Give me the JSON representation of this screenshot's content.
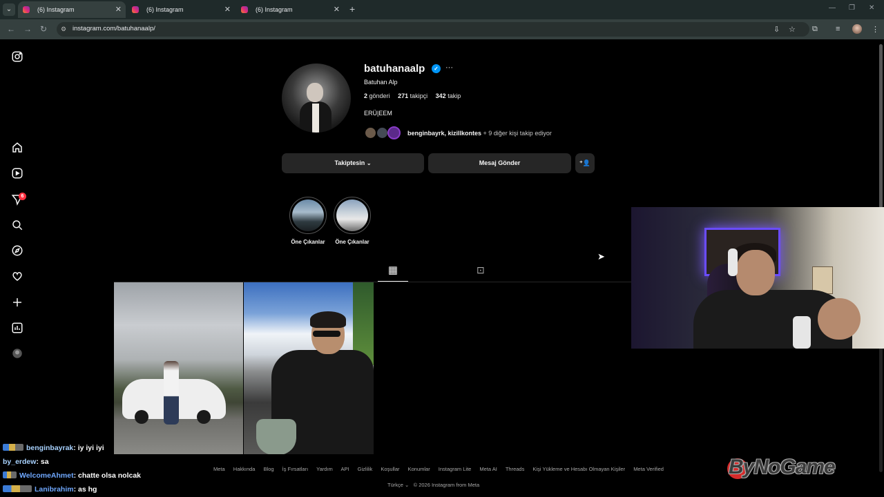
{
  "browser": {
    "tabs": [
      {
        "title": "(6) Instagram",
        "active": true
      },
      {
        "title": "(6) Instagram",
        "active": false
      },
      {
        "title": "(6) Instagram",
        "active": false
      }
    ],
    "url": "instagram.com/batuhanaalp/"
  },
  "profile": {
    "username": "batuhanaalp",
    "full_name": "Batuhan Alp",
    "posts_count": "2",
    "posts_label": "gönderi",
    "followers_count": "271",
    "followers_label": "takipçi",
    "following_count": "342",
    "following_label": "takip",
    "bio": "ERÜ|EEM",
    "followed_by_names": "benginbayrk, kizillkontes",
    "followed_by_rest": " + 9 diğer kişi takip ediyor"
  },
  "actions": {
    "following_button": "Takiptesin",
    "message_button": "Mesaj Gönder"
  },
  "highlights": [
    {
      "label": "Öne Çıkanlar"
    },
    {
      "label": "Öne Çıkanlar"
    }
  ],
  "sidebar": {
    "notification_badge": "6"
  },
  "chat": [
    {
      "user": "benginbayrak",
      "message": ": iy iyi iyi"
    },
    {
      "user": "by_erdew",
      "message": ": sa"
    },
    {
      "user": "WelcomeAhmet",
      "message": ": chatte olsa nolcak"
    },
    {
      "user": "Lanibrahim",
      "message": ": as hg"
    }
  ],
  "footer": {
    "links": [
      "Meta",
      "Hakkında",
      "Blog",
      "İş Fırsatları",
      "Yardım",
      "API",
      "Gizlilik",
      "Koşullar",
      "Konumlar",
      "Instagram Lite",
      "Meta AI",
      "Threads",
      "Kişi Yükleme ve Hesabı Olmayan Kişiler",
      "Meta Verified"
    ],
    "language": "Türkçe",
    "copyright": "© 2026 Instagram from Meta"
  },
  "watermark": "ByNoGame",
  "colors": {
    "accent_blue": "#0095f6",
    "badge_red": "#ff3040",
    "button_bg": "#262626"
  }
}
